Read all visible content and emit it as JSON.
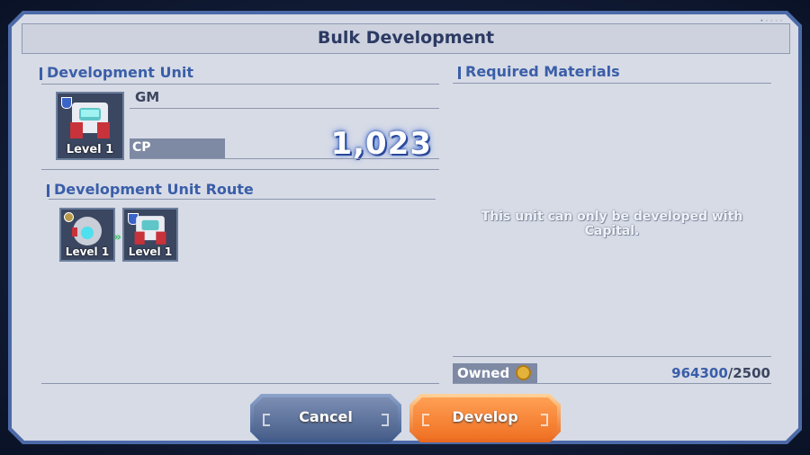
{
  "dialog": {
    "title": "Bulk Development",
    "top_tag": "• ◦ ◦ ◦ ◦"
  },
  "development_unit": {
    "heading": "Development Unit",
    "name": "GM",
    "level_label": "Level 1",
    "cp_label": "CP",
    "cp_value": "1,023"
  },
  "route": {
    "heading": "Development Unit Route",
    "units": [
      {
        "level_label": "Level 1",
        "icon": "ball-pod-icon"
      },
      {
        "level_label": "Level 1",
        "icon": "gm-mech-icon"
      }
    ]
  },
  "materials": {
    "heading": "Required Materials",
    "message": "This unit can only be developed with Capital.",
    "owned_label": "Owned",
    "owned_value": "964300",
    "required_value": "/2500"
  },
  "buttons": {
    "cancel": "Cancel",
    "develop": "Develop"
  },
  "colors": {
    "accent_blue": "#3a5ea8",
    "develop_orange": "#f07224",
    "cancel_blue": "#485f8a"
  }
}
